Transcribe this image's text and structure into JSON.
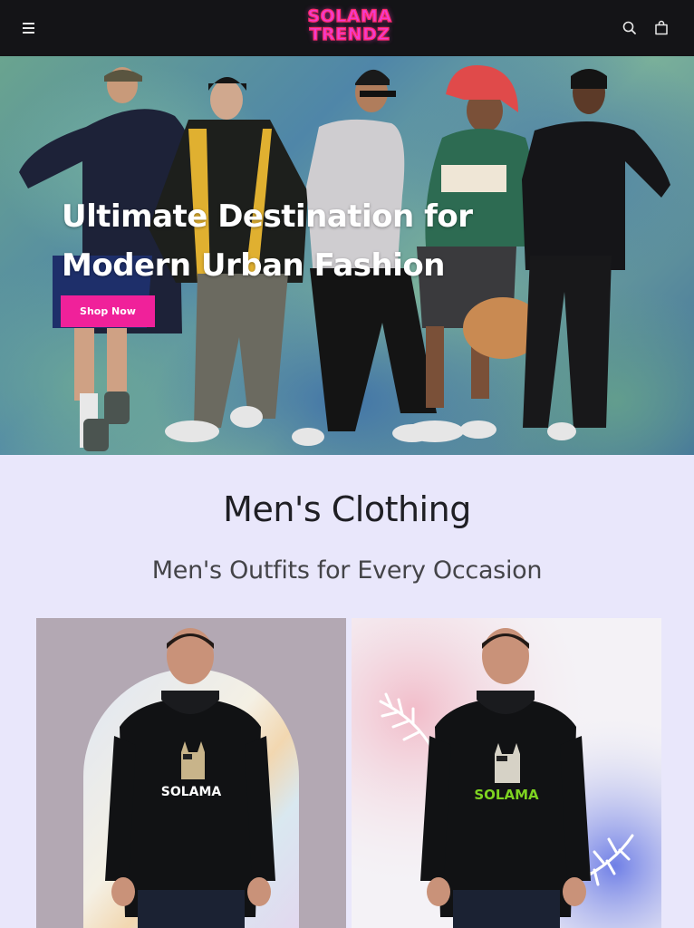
{
  "header": {
    "menu_icon": "hamburger-menu-icon",
    "logo_line1": "SOLAMA",
    "logo_line2": "TRENDZ",
    "search_icon": "search-icon",
    "cart_icon": "shopping-bag-icon",
    "background": "#141417",
    "logo_color": "#f03cd0"
  },
  "hero": {
    "title": "Ultimate Destination for Modern Urban Fashion",
    "cta_label": "Shop Now",
    "cta_color": "#f0219a"
  },
  "section": {
    "title": "Men's Clothing",
    "subtitle": "Men's Outfits for Every Occasion"
  },
  "products": [
    {
      "print_text": "SOLAMA",
      "print_color": "#ffffff",
      "background": "#b3a8b3"
    },
    {
      "print_text": "SOLAMA",
      "print_color": "#7ed321",
      "background": "#f4f2f6"
    }
  ]
}
